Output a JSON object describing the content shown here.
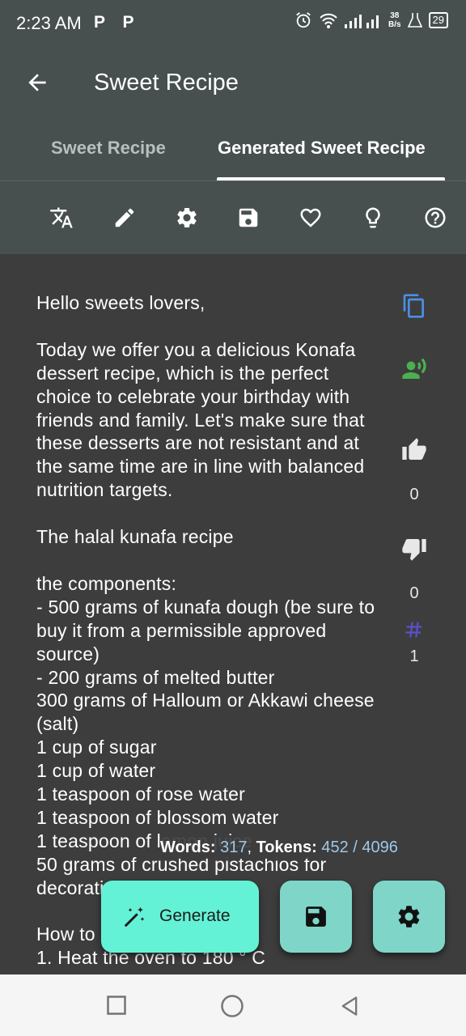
{
  "status_bar": {
    "time": "2:23 AM",
    "left_icons": "P P",
    "net_speed_value": "38",
    "net_speed_unit": "B/s",
    "battery": "29"
  },
  "app_bar": {
    "title": "Sweet Recipe"
  },
  "tabs": [
    {
      "label": "Sweet Recipe",
      "active": false
    },
    {
      "label": "Generated Sweet Recipe",
      "active": true
    }
  ],
  "toolbar_icons": [
    "translate-icon",
    "edit-icon",
    "settings-icon",
    "save-icon",
    "favorite-icon",
    "lightbulb-icon",
    "help-icon"
  ],
  "recipe_text": "Hello sweets lovers,\n\nToday we offer you a delicious Konafa dessert recipe, which is the perfect choice to celebrate your birthday with friends and family. Let's make sure that these desserts are not resistant and at the same time are in line with balanced nutrition targets.\n\nThe halal kunafa recipe\n\nthe components:\n- 500 grams of kunafa dough (be sure to buy it from a permissible approved source)\n- 200 grams of melted butter\n300 grams of Halloum or Akkawi cheese (salt)\n1 cup of sugar\n1 cup of water\n1 teaspoon of rose water\n1 teaspoon of blossom water\n1 teaspoon of lemon juice\n50 grams of crushed pistachios for decoration\n\nHow to prepare:\n1. Heat the oven to 180 ° C",
  "side_actions": {
    "likes": "0",
    "dislikes": "0",
    "hash_count": "1"
  },
  "stats": {
    "words_label": "Words:",
    "words_value": "317",
    "separator": ",",
    "tokens_label": "Tokens:",
    "tokens_value": "452 / 4096"
  },
  "fab": {
    "generate_label": "Generate"
  },
  "colors": {
    "appbar": "#474f4f",
    "background": "#3d3d3d",
    "generate_fab": "#64f2d6",
    "square_fab": "#7fd6c8",
    "copy_icon": "#4a8fe7",
    "speak_icon": "#4caf50",
    "hash_icon": "#5b4fc7",
    "stat_value": "#9ec7e8"
  }
}
